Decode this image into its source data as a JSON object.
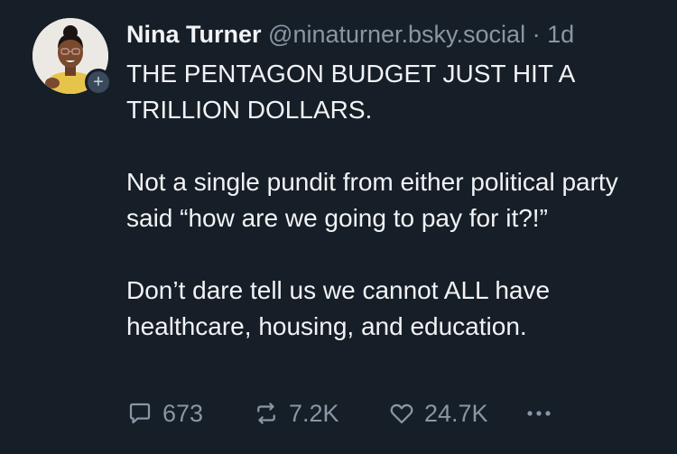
{
  "post": {
    "author": {
      "display_name": "Nina Turner",
      "handle": "@ninaturner.bsky.social",
      "separator": "·",
      "time": "1d",
      "follow_symbol": "+"
    },
    "paragraphs": [
      "THE PENTAGON BUDGET JUST HIT A TRILLION DOLLARS.",
      "Not a single pundit from either political party said “how are we going to pay for it?!”",
      "Don’t dare tell us we cannot ALL have healthcare, housing, and education."
    ],
    "actions": {
      "reply_count": "673",
      "repost_count": "7.2K",
      "like_count": "24.7K",
      "more_icon": "more-icon"
    }
  },
  "colors": {
    "background": "#161e27",
    "text": "#f1f3f5",
    "muted": "#8a96a5",
    "badge": "#3a4a5c"
  },
  "icons": [
    "reply-icon",
    "repost-icon",
    "heart-icon",
    "more-icon",
    "plus-icon"
  ]
}
